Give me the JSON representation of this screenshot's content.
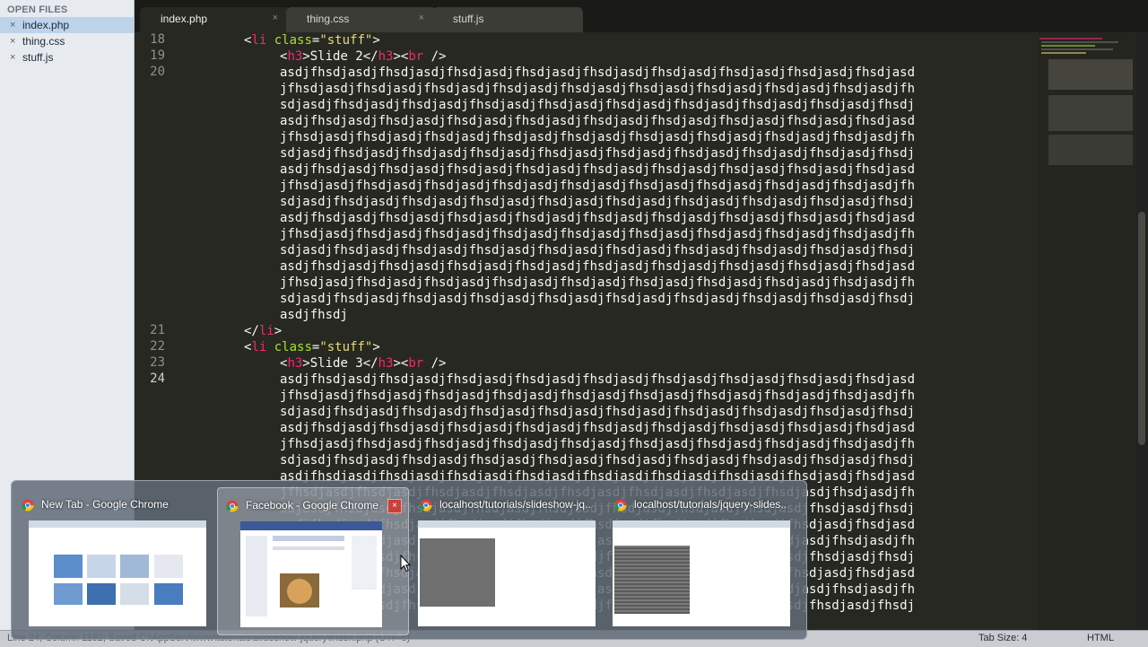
{
  "sidebar": {
    "header": "OPEN FILES",
    "files": [
      {
        "name": "index.php",
        "selected": true
      },
      {
        "name": "thing.css",
        "selected": false
      },
      {
        "name": "stuff.js",
        "selected": false
      }
    ],
    "close_glyph": "×"
  },
  "tabs": [
    {
      "label": "index.php",
      "active": true,
      "close": "×"
    },
    {
      "label": "thing.css",
      "active": false,
      "close": "×"
    },
    {
      "label": "stuff.js",
      "active": false,
      "close": ""
    }
  ],
  "editor": {
    "line_numbers": [
      "18",
      "19",
      "20",
      "21",
      "22",
      "23",
      "24"
    ],
    "current_line": "24",
    "colors": {
      "background": "#272822",
      "tag": "#f92672",
      "attribute": "#a6e22e",
      "string": "#e6db74",
      "text": "#f8f8f2"
    },
    "wrap_rows": [
      "asdjfhsdjasdjfhsdjasdjfhsdjasdjfhsdjasdjfhsdjasdjfhsdjasdjfhsdjasdjfhsdjasdjfhsdjasd",
      "jfhsdjasdjfhsdjasdjfhsdjasdjfhsdjasdjfhsdjasdjfhsdjasdjfhsdjasdjfhsdjasdjfhsdjasdjfh",
      "sdjasdjfhsdjasdjfhsdjasdjfhsdjasdjfhsdjasdjfhsdjasdjfhsdjasdjfhsdjasdjfhsdjasdjfhsdj"
    ],
    "tail_row": "asdjfhsdj",
    "li_open": {
      "tag_open": "<",
      "tag": "li",
      "attr": "class",
      "eq": "=",
      "value": "\"stuff\"",
      "close": ">"
    },
    "li_close": {
      "open": "</",
      "tag": "li",
      "close": ">"
    },
    "slide2": {
      "pre": "<",
      "h3": "h3",
      "mid": ">Slide 2</",
      "h3b": "h3",
      "mid2": "><",
      "br": "br",
      "end": " />"
    },
    "slide3": {
      "pre": "<",
      "h3": "h3",
      "mid": ">Slide 3</",
      "h3b": "h3",
      "mid2": "><",
      "br": "br",
      "end": " />"
    }
  },
  "preview": {
    "windows": [
      {
        "title": "New Tab - Google Chrome",
        "hovered": false
      },
      {
        "title": "Facebook - Google Chrome",
        "hovered": true
      },
      {
        "title": "localhost/tutorials/slideshow-jq...",
        "hovered": false
      },
      {
        "title": "localhost/tutorials/jquery-slides...",
        "hovered": false
      }
    ],
    "close_glyph": "×"
  },
  "status": {
    "left_text": "Line 24, Column 1182; Saved C:\\AppServ\\www\\tutorials\\slideshow-jquery\\index.php (UTF-8)",
    "tab_size": "Tab Size: 4",
    "syntax": "HTML"
  }
}
